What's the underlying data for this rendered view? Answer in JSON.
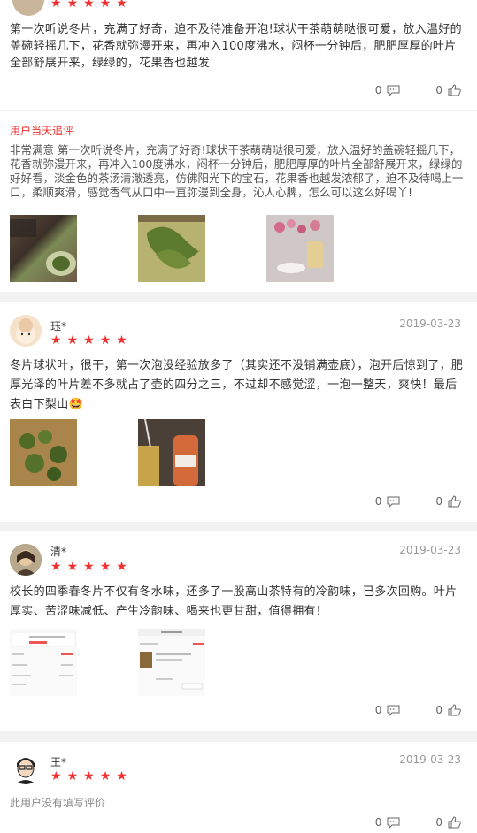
{
  "reviews": [
    {
      "stars": 5,
      "text": "第一次听说冬片，充满了好奇，迫不及待准备开泡!球状干茶萌萌哒很可爱，放入温好的盖碗轻摇几下，花香就弥漫开来，再冲入100度沸水，闷杯一分钟后，肥肥厚厚的叶片全部舒展开来，绿绿的，花果香也越发",
      "comment_count": "0",
      "like_count": "0",
      "followup": {
        "label": "用户当天追评",
        "text": "非常满意 第一次听说冬片，充满了好奇!球状干茶萌萌哒很可爱，放入温好的盖碗轻摇几下，花香就弥漫开来，再冲入100度沸水，闷杯一分钟后，肥肥厚厚的叶片全部舒展开来，绿绿的好好看，淡金色的茶汤清澈透亮，仿佛阳光下的宝石，花果香也越发浓郁了，迫不及待喝上一口，柔顺爽滑，感觉香气从口中一直弥漫到全身，沁人心脾，怎么可以这么好喝丫!"
      }
    },
    {
      "username": "珏*",
      "date": "2019-03-23",
      "stars": 5,
      "text": "冬片球状叶，很干，第一次泡没经验放多了（其实还不没铺满壶底），泡开后惊到了，肥厚光泽的叶片差不多就占了壶的四分之三，不过却不感觉涩，一泡一整天，爽快！最后表白下梨山🤩",
      "comment_count": "0",
      "like_count": "0"
    },
    {
      "username": "清*",
      "date": "2019-03-23",
      "stars": 5,
      "text": "校长的四季春冬片不仅有冬水味，还多了一股高山茶特有的冷韵味，已多次回购。叶片厚实、苦涩味减低、产生冷韵味、喝来也更甘甜，值得拥有！",
      "comment_count": "0",
      "like_count": "0"
    },
    {
      "username": "王*",
      "date": "2019-03-23",
      "stars": 5,
      "text": "此用户没有填写评价",
      "comment_count": "0",
      "like_count": "0"
    }
  ],
  "colors": {
    "accent": "#f23030",
    "star": "#f23030"
  },
  "icons": {
    "star": "star-icon",
    "comment": "comment-icon",
    "like": "thumbs-up-icon"
  }
}
